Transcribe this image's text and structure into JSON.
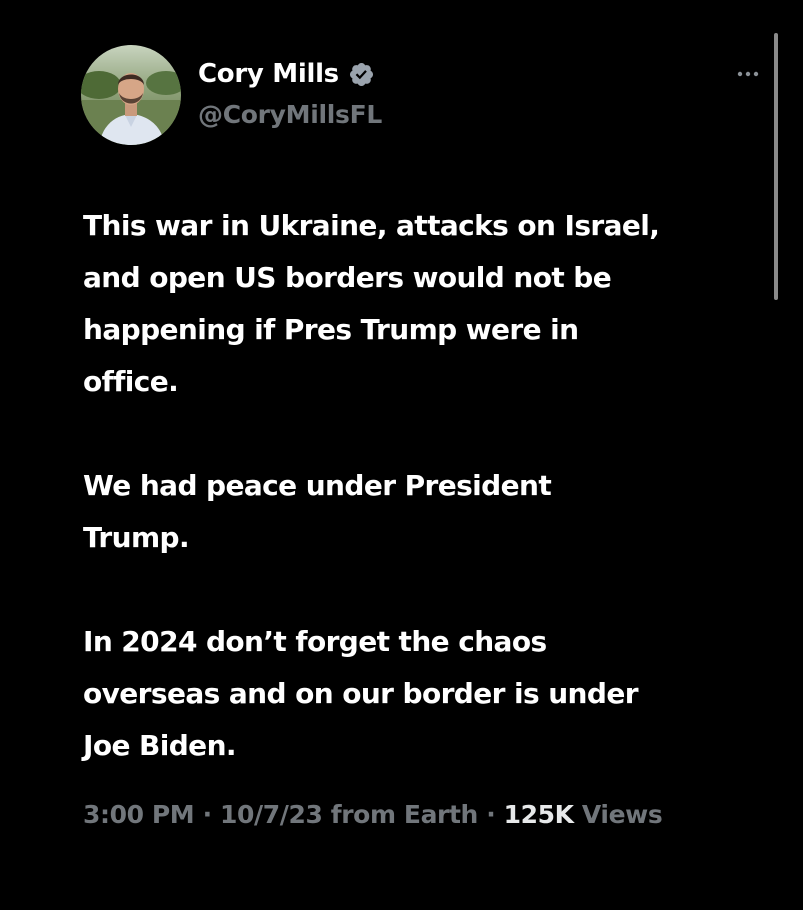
{
  "author": {
    "display_name": "Cory Mills",
    "handle": "@CoryMillsFL",
    "verified": true
  },
  "icons": {
    "verified": "verified-badge-icon",
    "more": "more-options-icon"
  },
  "tweet": {
    "paragraphs": [
      "This war in Ukraine, attacks on Israel,\nand open US borders would not be\nhappening if Pres Trump were in\noffice.",
      "We had peace under President\nTrump.",
      " In 2024 don’t forget the chaos\noverseas and on our border is under\nJoe Biden."
    ]
  },
  "meta": {
    "time": "3:00 PM",
    "separator": " · ",
    "date": "10/7/23",
    "source": " from Earth",
    "views_count": "125K",
    "views_label": " Views"
  },
  "colors": {
    "background": "#000000",
    "text": "#ffffff",
    "secondary": "#71767b",
    "verified_badge": "#9aa3ad"
  }
}
